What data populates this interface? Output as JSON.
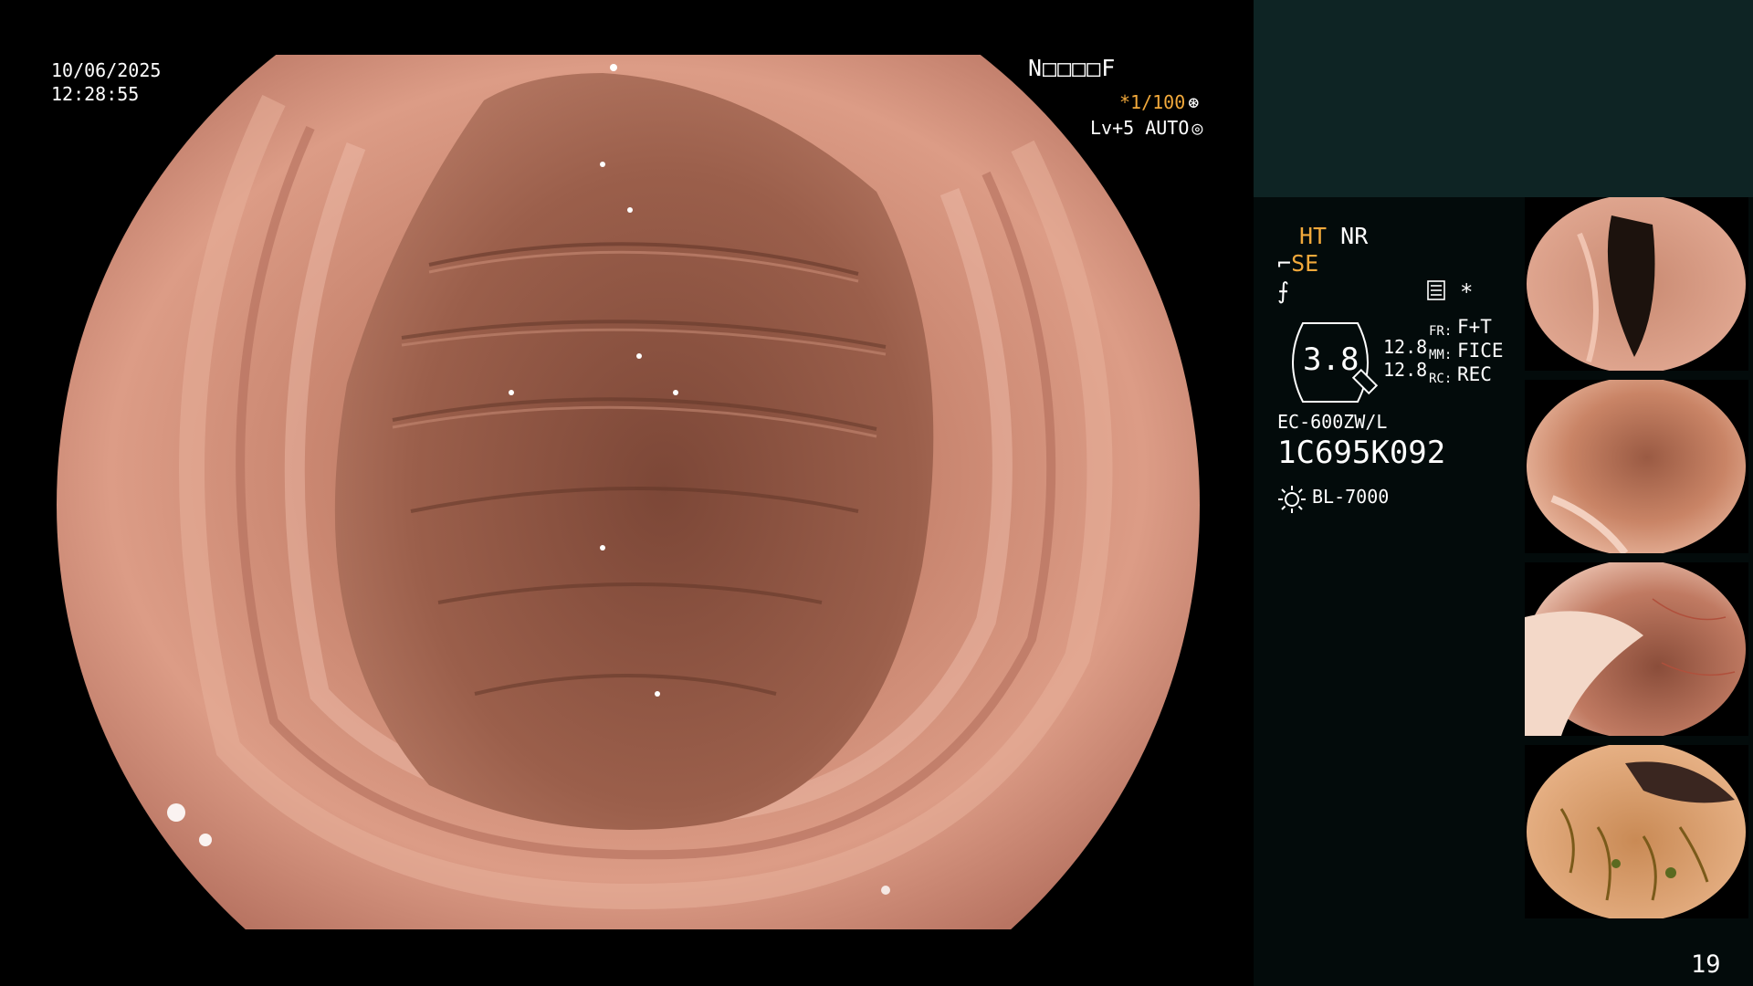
{
  "main": {
    "date": "10/06/2025",
    "time": "12:28:55",
    "patient_id": "N□□□□F",
    "shutter_value": "*1/100",
    "shutter_icon": "shutter-icon",
    "level_value": "Lv+5 AUTO",
    "level_icon": "aperture-icon"
  },
  "panel": {
    "ht": "HT",
    "nr": "NR",
    "se": "SE",
    "structure_icon": "structure-enhancement-icon",
    "color_icon": "color-enhancement-icon",
    "list_icon": "menu-list-icon",
    "asterisk": "*",
    "zoom_value": "3.8",
    "zoom_icon": "zoom-badge-icon",
    "value_top": "12.8",
    "value_bottom": "12.8",
    "label_fr": "FR:",
    "label_mm": "MM:",
    "label_rc": "RC:",
    "fr_value": "F+T",
    "mm_value": "FICE",
    "rc_value": "REC",
    "scope_model": "EC-600ZW/L",
    "scope_serial": "1C695K092",
    "light_icon": "sun-icon",
    "light_source": "BL-7000",
    "page_number": "19"
  },
  "colors": {
    "amber": "#f2a93b",
    "panel_bg": "#030b0b",
    "panel_top": "#0e2424",
    "mucosa": "#cf8a73"
  }
}
